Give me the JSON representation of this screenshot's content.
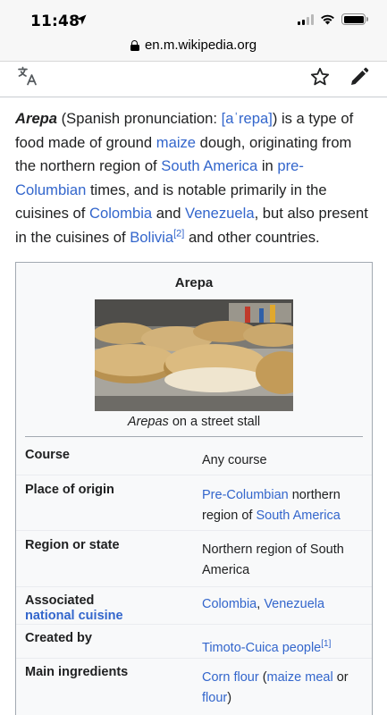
{
  "status_bar": {
    "time": "11:48"
  },
  "browser": {
    "url": "en.m.wikipedia.org"
  },
  "icons": {
    "language": "language-icon",
    "watch": "star-icon",
    "edit": "pencil-icon"
  },
  "intro": {
    "term": "Arepa",
    "t1": " (Spanish pronunciation: ",
    "ipa": "[aˈrepa]",
    "t2": ") is a type of food made of ground ",
    "link_maize": "maize",
    "t3": " dough, originating from the northern region of ",
    "link_south_america": "South America",
    "t4": " in ",
    "link_precolumbian": "pre-Columbian",
    "t5": " times, and is notable primarily in the cuisines of ",
    "link_colombia": "Colombia",
    "t6": " and ",
    "link_venezuela": "Venezuela",
    "t7": ", but also present in the cuisines of ",
    "link_bolivia": "Bolivia",
    "ref": "[2]",
    "t8": " and other countries."
  },
  "infobox": {
    "title": "Arepa",
    "caption_italic": "Arepas",
    "caption_rest": " on a street stall",
    "rows": {
      "course": {
        "label": "Course",
        "value": "Any course"
      },
      "origin": {
        "label": "Place of origin",
        "link1": "Pre-Columbian",
        "text1": " northern region of ",
        "link2": "South America"
      },
      "region": {
        "label": "Region or state",
        "value": "Northern region of South America"
      },
      "cuisine": {
        "label": "Associated",
        "label_link": "national cuisine",
        "link1": "Colombia",
        "text1": ", ",
        "link2": "Venezuela"
      },
      "created": {
        "label": "Created by",
        "link1": "Timoto-Cuica people",
        "ref": "[1]"
      },
      "ingredients": {
        "label": "Main ingredients",
        "link1": "Corn flour",
        "text1": " (",
        "link2": "maize meal",
        "text2": " or ",
        "link3": "flour",
        "text3": ")"
      }
    }
  }
}
